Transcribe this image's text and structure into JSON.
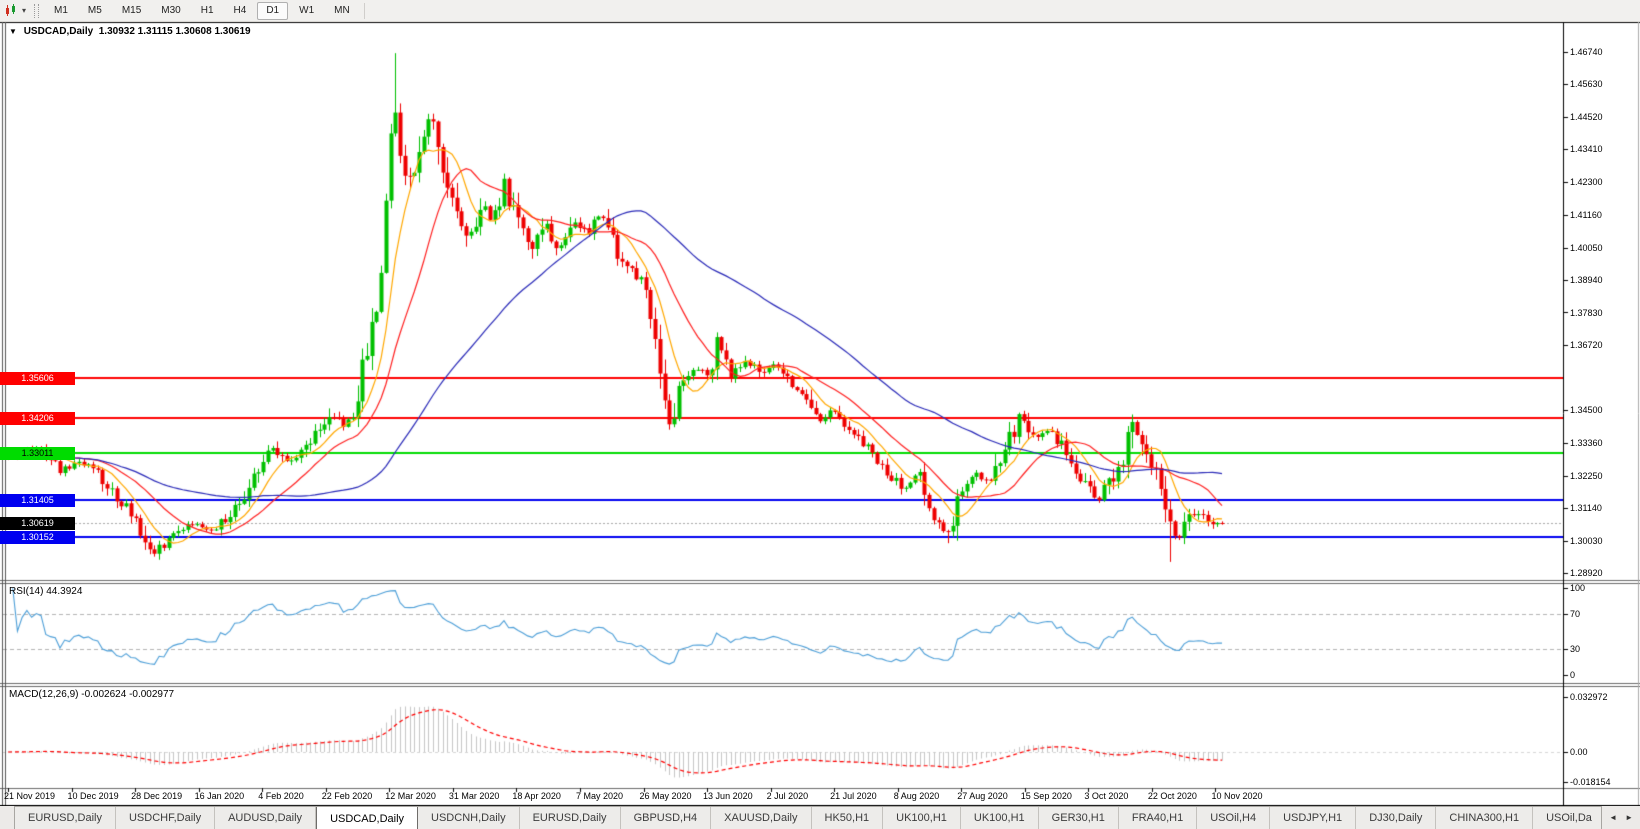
{
  "toolbar": {
    "chart_icon": "chart-periods-icon",
    "timeframes": [
      "M1",
      "M5",
      "M15",
      "M30",
      "H1",
      "H4",
      "D1",
      "W1",
      "MN"
    ],
    "active_timeframe": "D1"
  },
  "chart_header": {
    "symbol_period": "USDCAD,Daily",
    "open": "1.30932",
    "high": "1.31115",
    "low": "1.30608",
    "close": "1.30619"
  },
  "price_axis": {
    "tick_labels": [
      "1.46740",
      "1.45630",
      "1.44520",
      "1.43410",
      "1.42300",
      "1.41160",
      "1.40050",
      "1.38940",
      "1.37830",
      "1.36720",
      "1.34500",
      "1.33360",
      "1.32250",
      "1.31140",
      "1.30030",
      "1.28920"
    ]
  },
  "levels": [
    {
      "label": "1.35606",
      "value": 1.35606,
      "color": "#ff0000",
      "text_color": "#ffffff"
    },
    {
      "label": "1.34206",
      "value": 1.34206,
      "color": "#ff0000",
      "text_color": "#ffffff"
    },
    {
      "label": "1.33011",
      "value": 1.33011,
      "color": "#00dc00",
      "text_color": "#000000"
    },
    {
      "label": "1.31405",
      "value": 1.31405,
      "color": "#0000f0",
      "text_color": "#ffffff"
    },
    {
      "label": "1.30152",
      "value": 1.30152,
      "color": "#0000f0",
      "text_color": "#ffffff"
    }
  ],
  "current_price": {
    "label": "1.30619",
    "value": 1.30619,
    "badge_color": "#000000",
    "text_color": "#ffffff"
  },
  "rsi_panel": {
    "name": "RSI(14)",
    "value": "44.3924",
    "axis_ticks": [
      "100",
      "70",
      "30",
      "0"
    ],
    "axis_values": [
      100,
      70,
      30,
      0
    ],
    "upper_level": 70,
    "lower_level": 30,
    "line_color": "#4d9fd8"
  },
  "macd_panel": {
    "name": "MACD(12,26,9)",
    "values": "-0.002624 -0.002977",
    "axis_ticks": [
      "0.032972",
      "0.00",
      "-0.018154"
    ],
    "axis_values": [
      0.032972,
      0.0,
      -0.018154
    ],
    "hist_color": "#c6c6c6",
    "signal_color": "#ff0000"
  },
  "time_axis": {
    "dates": [
      "21 Nov 2019",
      "10 Dec 2019",
      "28 Dec 2019",
      "16 Jan 2020",
      "4 Feb 2020",
      "22 Feb 2020",
      "12 Mar 2020",
      "31 Mar 2020",
      "18 Apr 2020",
      "7 May 2020",
      "26 May 2020",
      "13 Jun 2020",
      "2 Jul 2020",
      "21 Jul 2020",
      "8 Aug 2020",
      "27 Aug 2020",
      "15 Sep 2020",
      "3 Oct 2020",
      "22 Oct 2020",
      "10 Nov 2020"
    ]
  },
  "tab_bar": {
    "tabs": [
      "EURUSD,Daily",
      "USDCHF,Daily",
      "AUDUSD,Daily",
      "USDCAD,Daily",
      "USDCNH,Daily",
      "EURUSD,Daily",
      "GBPUSD,H4",
      "XAUUSD,Daily",
      "HK50,H1",
      "UK100,H1",
      "UK100,H1",
      "GER30,H1",
      "FRA40,H1",
      "USOil,H4",
      "USDJPY,H1",
      "DJ30,Daily",
      "CHINA300,H1",
      "USOil,Da"
    ],
    "active_index": 3,
    "scroll_left_icon": "◄",
    "scroll_right_icon": "►"
  },
  "chart_data": {
    "type": "candlestick",
    "symbol": "USDCAD",
    "period": "Daily",
    "bar_count": 258,
    "ylim": [
      1.2868,
      1.4777
    ],
    "up_color": "#00c000",
    "down_color": "#ee0000",
    "last_close": 1.30619,
    "close_keyframes": [
      [
        0.0,
        1.329
      ],
      [
        0.026,
        1.332
      ],
      [
        0.043,
        1.325
      ],
      [
        0.068,
        1.3272
      ],
      [
        0.088,
        1.316
      ],
      [
        0.105,
        1.308
      ],
      [
        0.119,
        1.2955
      ],
      [
        0.133,
        1.3012
      ],
      [
        0.146,
        1.306
      ],
      [
        0.17,
        1.3036
      ],
      [
        0.191,
        1.313
      ],
      [
        0.206,
        1.3245
      ],
      [
        0.216,
        1.332
      ],
      [
        0.228,
        1.327
      ],
      [
        0.24,
        1.33
      ],
      [
        0.255,
        1.338
      ],
      [
        0.265,
        1.3445
      ],
      [
        0.275,
        1.339
      ],
      [
        0.286,
        1.343
      ],
      [
        0.294,
        1.363
      ],
      [
        0.302,
        1.378
      ],
      [
        0.31,
        1.405
      ],
      [
        0.318,
        1.453
      ],
      [
        0.325,
        1.43
      ],
      [
        0.333,
        1.422
      ],
      [
        0.342,
        1.439
      ],
      [
        0.35,
        1.445
      ],
      [
        0.359,
        1.428
      ],
      [
        0.368,
        1.414
      ],
      [
        0.379,
        1.404
      ],
      [
        0.389,
        1.415
      ],
      [
        0.399,
        1.41
      ],
      [
        0.409,
        1.422
      ],
      [
        0.42,
        1.408
      ],
      [
        0.432,
        1.399
      ],
      [
        0.442,
        1.409
      ],
      [
        0.453,
        1.4
      ],
      [
        0.465,
        1.41
      ],
      [
        0.478,
        1.406
      ],
      [
        0.489,
        1.412
      ],
      [
        0.5,
        1.4
      ],
      [
        0.512,
        1.393
      ],
      [
        0.525,
        1.387
      ],
      [
        0.535,
        1.362
      ],
      [
        0.544,
        1.339
      ],
      [
        0.553,
        1.354
      ],
      [
        0.566,
        1.359
      ],
      [
        0.578,
        1.356
      ],
      [
        0.585,
        1.368
      ],
      [
        0.595,
        1.358
      ],
      [
        0.607,
        1.362
      ],
      [
        0.619,
        1.357
      ],
      [
        0.632,
        1.36
      ],
      [
        0.644,
        1.3545
      ],
      [
        0.656,
        1.35
      ],
      [
        0.667,
        1.341
      ],
      [
        0.679,
        1.345
      ],
      [
        0.689,
        1.3385
      ],
      [
        0.702,
        1.3345
      ],
      [
        0.714,
        1.328
      ],
      [
        0.726,
        1.323
      ],
      [
        0.739,
        1.318
      ],
      [
        0.751,
        1.323
      ],
      [
        0.763,
        1.31
      ],
      [
        0.774,
        1.303
      ],
      [
        0.784,
        1.318
      ],
      [
        0.796,
        1.323
      ],
      [
        0.809,
        1.32
      ],
      [
        0.821,
        1.332
      ],
      [
        0.833,
        1.3415
      ],
      [
        0.844,
        1.335
      ],
      [
        0.857,
        1.339
      ],
      [
        0.868,
        1.333
      ],
      [
        0.879,
        1.325
      ],
      [
        0.889,
        1.318
      ],
      [
        0.899,
        1.314
      ],
      [
        0.909,
        1.322
      ],
      [
        0.92,
        1.33
      ],
      [
        0.926,
        1.3415
      ],
      [
        0.932,
        1.334
      ],
      [
        0.941,
        1.328
      ],
      [
        0.947,
        1.318
      ],
      [
        0.953,
        1.312
      ],
      [
        0.959,
        1.2985
      ],
      [
        0.965,
        1.301
      ],
      [
        0.973,
        1.308
      ],
      [
        0.982,
        1.3105
      ],
      [
        0.99,
        1.306
      ],
      [
        1.0,
        1.30619
      ]
    ],
    "extremes": [
      {
        "frac": 0.318,
        "high": 1.467
      },
      {
        "frac": 0.959,
        "low": 1.293
      },
      {
        "frac": 0.119,
        "low": 1.2948
      },
      {
        "frac": 0.774,
        "low": 1.2994
      },
      {
        "frac": 0.585,
        "high": 1.3715
      }
    ],
    "moving_averages": [
      {
        "window": 8,
        "color": "#ffa800"
      },
      {
        "window": 18,
        "color": "#ff2020"
      },
      {
        "window": 55,
        "color": "#2929b8"
      }
    ],
    "rsi": {
      "period": 14,
      "last": 44.3924
    },
    "macd": {
      "fast": 12,
      "slow": 26,
      "signal": 9,
      "last_main": -0.002624,
      "last_signal": -0.002977
    }
  }
}
